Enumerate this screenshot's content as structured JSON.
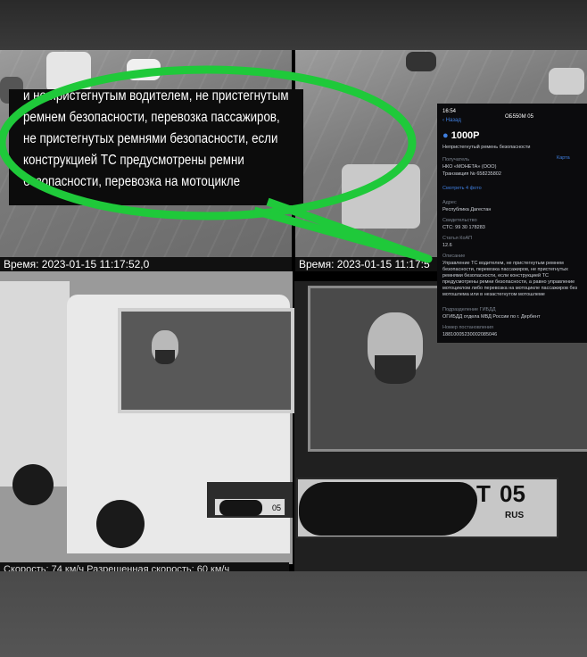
{
  "overlay_text": {
    "line1": "и не пристегнутым водителем, не пристегнутым",
    "line2": "ремнем безопасности, перевозка пассажиров,",
    "line3": "не пристегнутых ремнями безопасности, если",
    "line4": "конструкцией ТС предусмотрены ремни",
    "line5": "безопасности, перевозка на мотоцикле"
  },
  "captions": {
    "left": "Время: 2023-01-15 11:17:52,0",
    "right": "Время: 2023-01-15 11:17:5",
    "speed": "Скорость: 74 км/ч   Разрешенная скорость: 60 км/ч"
  },
  "phone": {
    "status_time": "16:54",
    "back_label": "Назад",
    "fine_id": "ОБ550М 05",
    "amount": "1000Р",
    "violation": "Непристегнутый ремень безопасности",
    "recipient_label": "Получатель",
    "recipient": "НКО «МОНЕТА» (ООО)",
    "recipient_sub": "Транзакция № 658235802",
    "map_link": "Карта",
    "photos_link": "Смотреть 4 фото",
    "region_label": "Адрес",
    "region": "Республика Дагестан",
    "sts_label": "Свидетельство",
    "sts": "СТС: 99 30 178283",
    "article_label": "Статья КоАП",
    "article": "12.6",
    "desc_label": "Описание",
    "desc": "Управление ТС водителем, не пристегнутым ремнем безопасности, перевозка пассажиров, не пристегнутых ремнями безопасности, если конструкцией ТС предусмотрены ремни безопасности, а равно управление мотоциклом либо перевозка на мотоцикле пассажиров без мотошлема или в незастегнутом мотошлеме",
    "dept_label": "Подразделение ГИБДД",
    "dept": "ОГИБДД отдела МВД России по г. Дербент",
    "uin_label": "Номер постановления",
    "uin": "18810005230002085046"
  },
  "truck_plate": "05",
  "plate": {
    "letter": "Т",
    "region": "05",
    "country": "RUS"
  },
  "colors": {
    "overlay_ellipse": "#1fc93a",
    "phone_background": "#0b0b0d",
    "phone_accent": "#3f7fe0"
  }
}
